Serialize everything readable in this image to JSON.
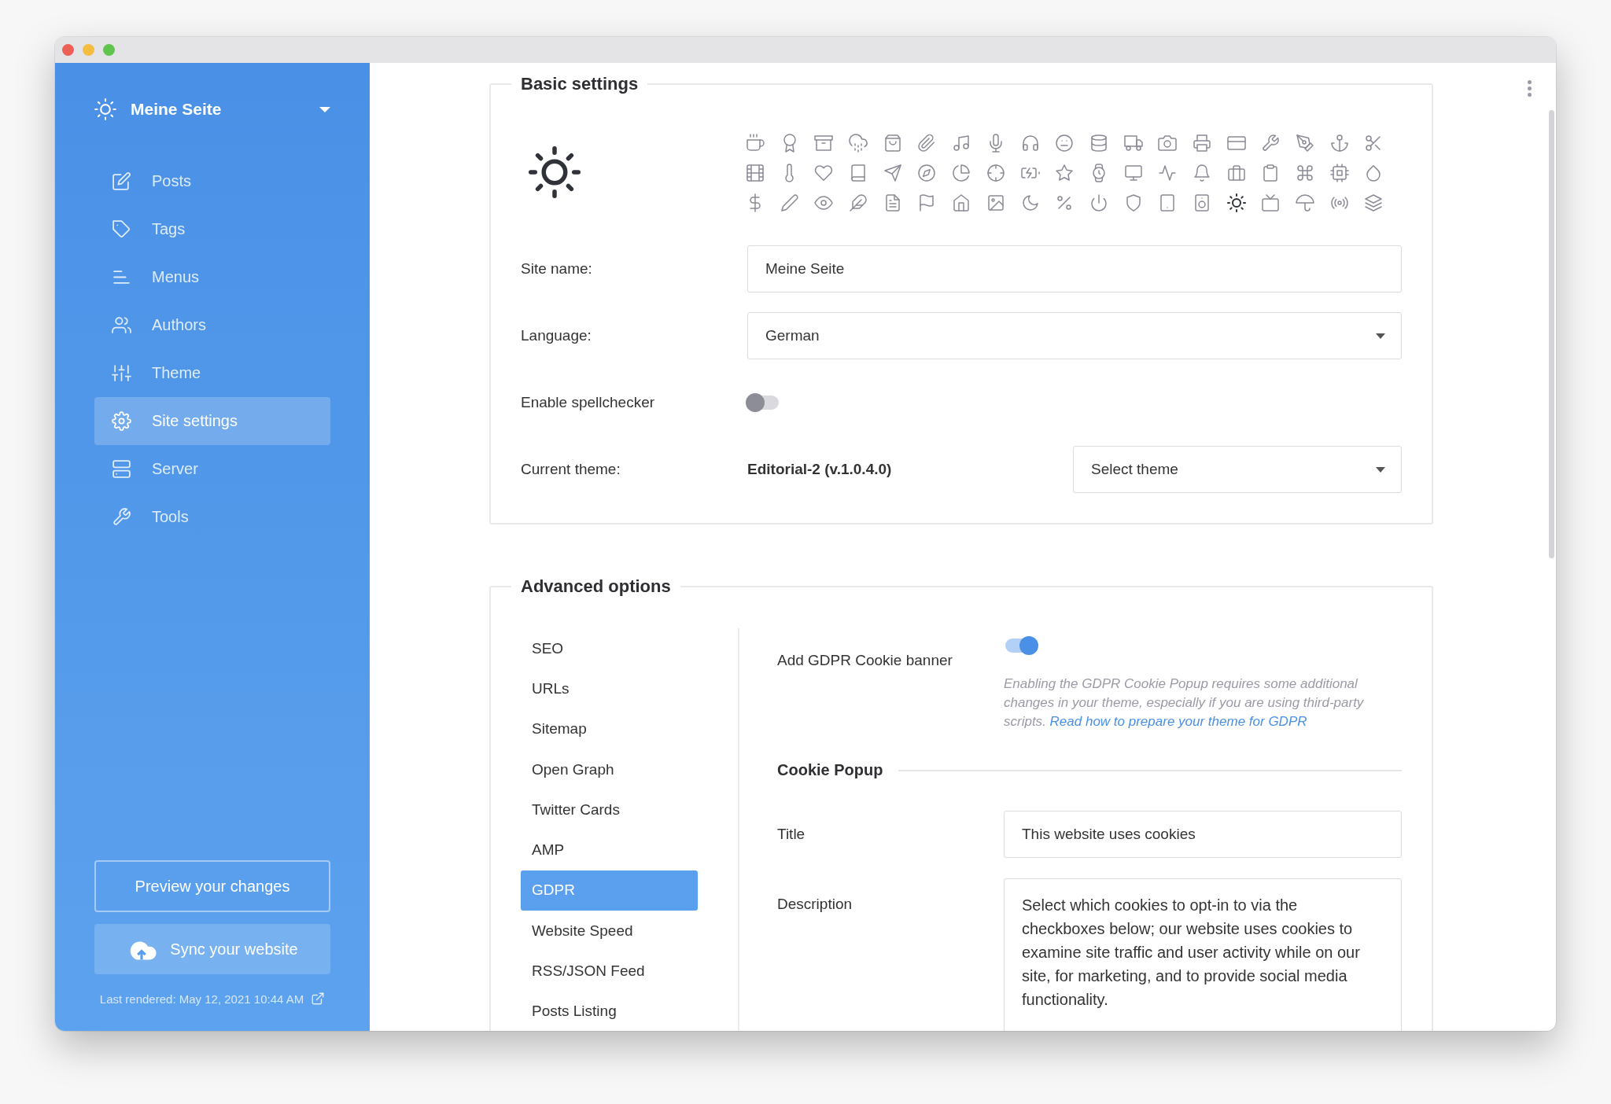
{
  "sidebar": {
    "site": {
      "name": "Meine Seite"
    },
    "items": [
      {
        "label": "Posts",
        "kind": "edit",
        "selected": false
      },
      {
        "label": "Tags",
        "kind": "tag",
        "selected": false
      },
      {
        "label": "Menus",
        "kind": "menu",
        "selected": false
      },
      {
        "label": "Authors",
        "kind": "users",
        "selected": false
      },
      {
        "label": "Theme",
        "kind": "sliders",
        "selected": false
      },
      {
        "label": "Site settings",
        "kind": "settings",
        "selected": true
      },
      {
        "label": "Server",
        "kind": "server",
        "selected": false
      },
      {
        "label": "Tools",
        "kind": "tool",
        "selected": false
      }
    ],
    "preview_button": "Preview your changes",
    "sync_button": "Sync your website",
    "last_rendered": "Last rendered: May 12, 2021 10:44 AM"
  },
  "basic_settings": {
    "legend": "Basic settings",
    "icons": [
      {
        "kind": "coffee-cup",
        "selected": false
      },
      {
        "kind": "award",
        "selected": false
      },
      {
        "kind": "archive",
        "selected": false
      },
      {
        "kind": "cloud-drizzle",
        "selected": false
      },
      {
        "kind": "shopping-bag",
        "selected": false
      },
      {
        "kind": "paperclip",
        "selected": false
      },
      {
        "kind": "music-note",
        "selected": false
      },
      {
        "kind": "microphone",
        "selected": false
      },
      {
        "kind": "headphones",
        "selected": false
      },
      {
        "kind": "neutral-face",
        "selected": false
      },
      {
        "kind": "database",
        "selected": false
      },
      {
        "kind": "truck",
        "selected": false
      },
      {
        "kind": "camera",
        "selected": false
      },
      {
        "kind": "printer",
        "selected": false
      },
      {
        "kind": "credit-card",
        "selected": false
      },
      {
        "kind": "wrench",
        "selected": false
      },
      {
        "kind": "pen-nib",
        "selected": false
      },
      {
        "kind": "anchor",
        "selected": false
      },
      {
        "kind": "scissors",
        "selected": false
      },
      {
        "kind": "film",
        "selected": false
      },
      {
        "kind": "thermometer",
        "selected": false
      },
      {
        "kind": "heart",
        "selected": false
      },
      {
        "kind": "book",
        "selected": false
      },
      {
        "kind": "paper-plane",
        "selected": false
      },
      {
        "kind": "compass",
        "selected": false
      },
      {
        "kind": "pie-chart",
        "selected": false
      },
      {
        "kind": "crosshair",
        "selected": false
      },
      {
        "kind": "battery-charging",
        "selected": false
      },
      {
        "kind": "star",
        "selected": false
      },
      {
        "kind": "watch",
        "selected": false
      },
      {
        "kind": "monitor",
        "selected": false
      },
      {
        "kind": "pulse",
        "selected": false
      },
      {
        "kind": "bell",
        "selected": false
      },
      {
        "kind": "briefcase",
        "selected": false
      },
      {
        "kind": "clipboard",
        "selected": false
      },
      {
        "kind": "command-key",
        "selected": false
      },
      {
        "kind": "cpu",
        "selected": false
      },
      {
        "kind": "droplet",
        "selected": false
      },
      {
        "kind": "dollar",
        "selected": false
      },
      {
        "kind": "pencil",
        "selected": false
      },
      {
        "kind": "eye",
        "selected": false
      },
      {
        "kind": "feather",
        "selected": false
      },
      {
        "kind": "document",
        "selected": false
      },
      {
        "kind": "flag",
        "selected": false
      },
      {
        "kind": "house",
        "selected": false
      },
      {
        "kind": "image",
        "selected": false
      },
      {
        "kind": "moon",
        "selected": false
      },
      {
        "kind": "percent",
        "selected": false
      },
      {
        "kind": "power",
        "selected": false
      },
      {
        "kind": "shield",
        "selected": false
      },
      {
        "kind": "tablet",
        "selected": false
      },
      {
        "kind": "speaker",
        "selected": false
      },
      {
        "kind": "sun",
        "selected": true
      },
      {
        "kind": "tv",
        "selected": false
      },
      {
        "kind": "umbrella",
        "selected": false
      },
      {
        "kind": "radio-waves",
        "selected": false
      },
      {
        "kind": "layers",
        "selected": false
      }
    ],
    "fields": [
      {
        "kind": "text",
        "label": "Site name:",
        "value": "Meine Seite"
      },
      {
        "kind": "select",
        "label": "Language:",
        "value": "German"
      },
      {
        "kind": "toggle",
        "label": "Enable spellchecker",
        "on": false
      },
      {
        "kind": "theme",
        "label": "Current theme:",
        "value": "Editorial-2 (v.1.0.4.0)",
        "placeholder": "Select theme"
      }
    ]
  },
  "advanced_options": {
    "legend": "Advanced options",
    "tabs": [
      {
        "label": "SEO",
        "selected": false
      },
      {
        "label": "URLs",
        "selected": false
      },
      {
        "label": "Sitemap",
        "selected": false
      },
      {
        "label": "Open Graph",
        "selected": false
      },
      {
        "label": "Twitter Cards",
        "selected": false
      },
      {
        "label": "AMP",
        "selected": false
      },
      {
        "label": "GDPR",
        "selected": true
      },
      {
        "label": "Website Speed",
        "selected": false
      },
      {
        "label": "RSS/JSON Feed",
        "selected": false
      },
      {
        "label": "Posts Listing",
        "selected": false
      }
    ],
    "gdpr": {
      "banner_label": "Add GDPR Cookie banner",
      "banner_on": true,
      "help": "Enabling the GDPR Cookie Popup requires some additional changes in your theme, especially if you are using third-party scripts.",
      "help_link": "Read how to prepare your theme for GDPR",
      "section": "Cookie Popup",
      "title_label": "Title",
      "title_value": "This website uses cookies",
      "description_label": "Description",
      "description_value": "Select which cookies to opt-in to via the checkboxes below; our website uses cookies to examine site traffic and user activity while on our site, for marketing, and to provide social media functionality."
    }
  }
}
